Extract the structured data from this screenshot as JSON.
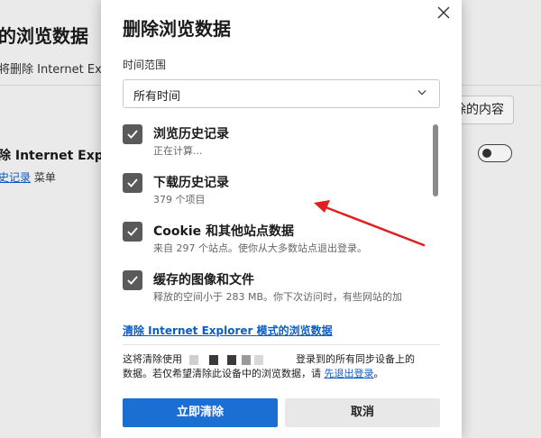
{
  "background": {
    "title": "的浏览数据",
    "description": "将删除 Internet Ex",
    "choose_button_label": "除的内容",
    "ie_setting_label": "除 Internet Explo",
    "ie_setting_link": "史记录",
    "ie_setting_suffix": " 菜单",
    "ie_toggle_on": false
  },
  "dialog": {
    "title": "删除浏览数据",
    "close_icon": "close-icon",
    "time_range": {
      "label": "时间范围",
      "selected": "所有时间"
    },
    "items": [
      {
        "label": "浏览历史记录",
        "sub": "正在计算...",
        "checked": true
      },
      {
        "label": "下载历史记录",
        "sub": "379 个项目",
        "checked": true
      },
      {
        "label": "Cookie 和其他站点数据",
        "sub": "来自 297 个站点。使你从大多数站点退出登录。",
        "checked": true
      },
      {
        "label": "缓存的图像和文件",
        "sub": "释放的空间小于 283 MB。你下次访问时，有些网站的加",
        "checked": true
      }
    ],
    "ie_link": "清除 Internet Explorer 模式的浏览数据",
    "sync_note": {
      "line1_prefix": "这将清除使用",
      "line1_suffix": "登录到的所有同步设备上的",
      "line2_prefix": "数据。若仅希望清除此设备中的浏览数据，请 ",
      "signout_link": "先退出登录",
      "line2_suffix": "。"
    },
    "clear_button": "立即清除",
    "cancel_button": "取消"
  },
  "colors": {
    "accent": "#1b6fd3",
    "link": "#0a5ec8",
    "checkbox": "#5a5a5a",
    "annotation_arrow": "#e02020"
  }
}
